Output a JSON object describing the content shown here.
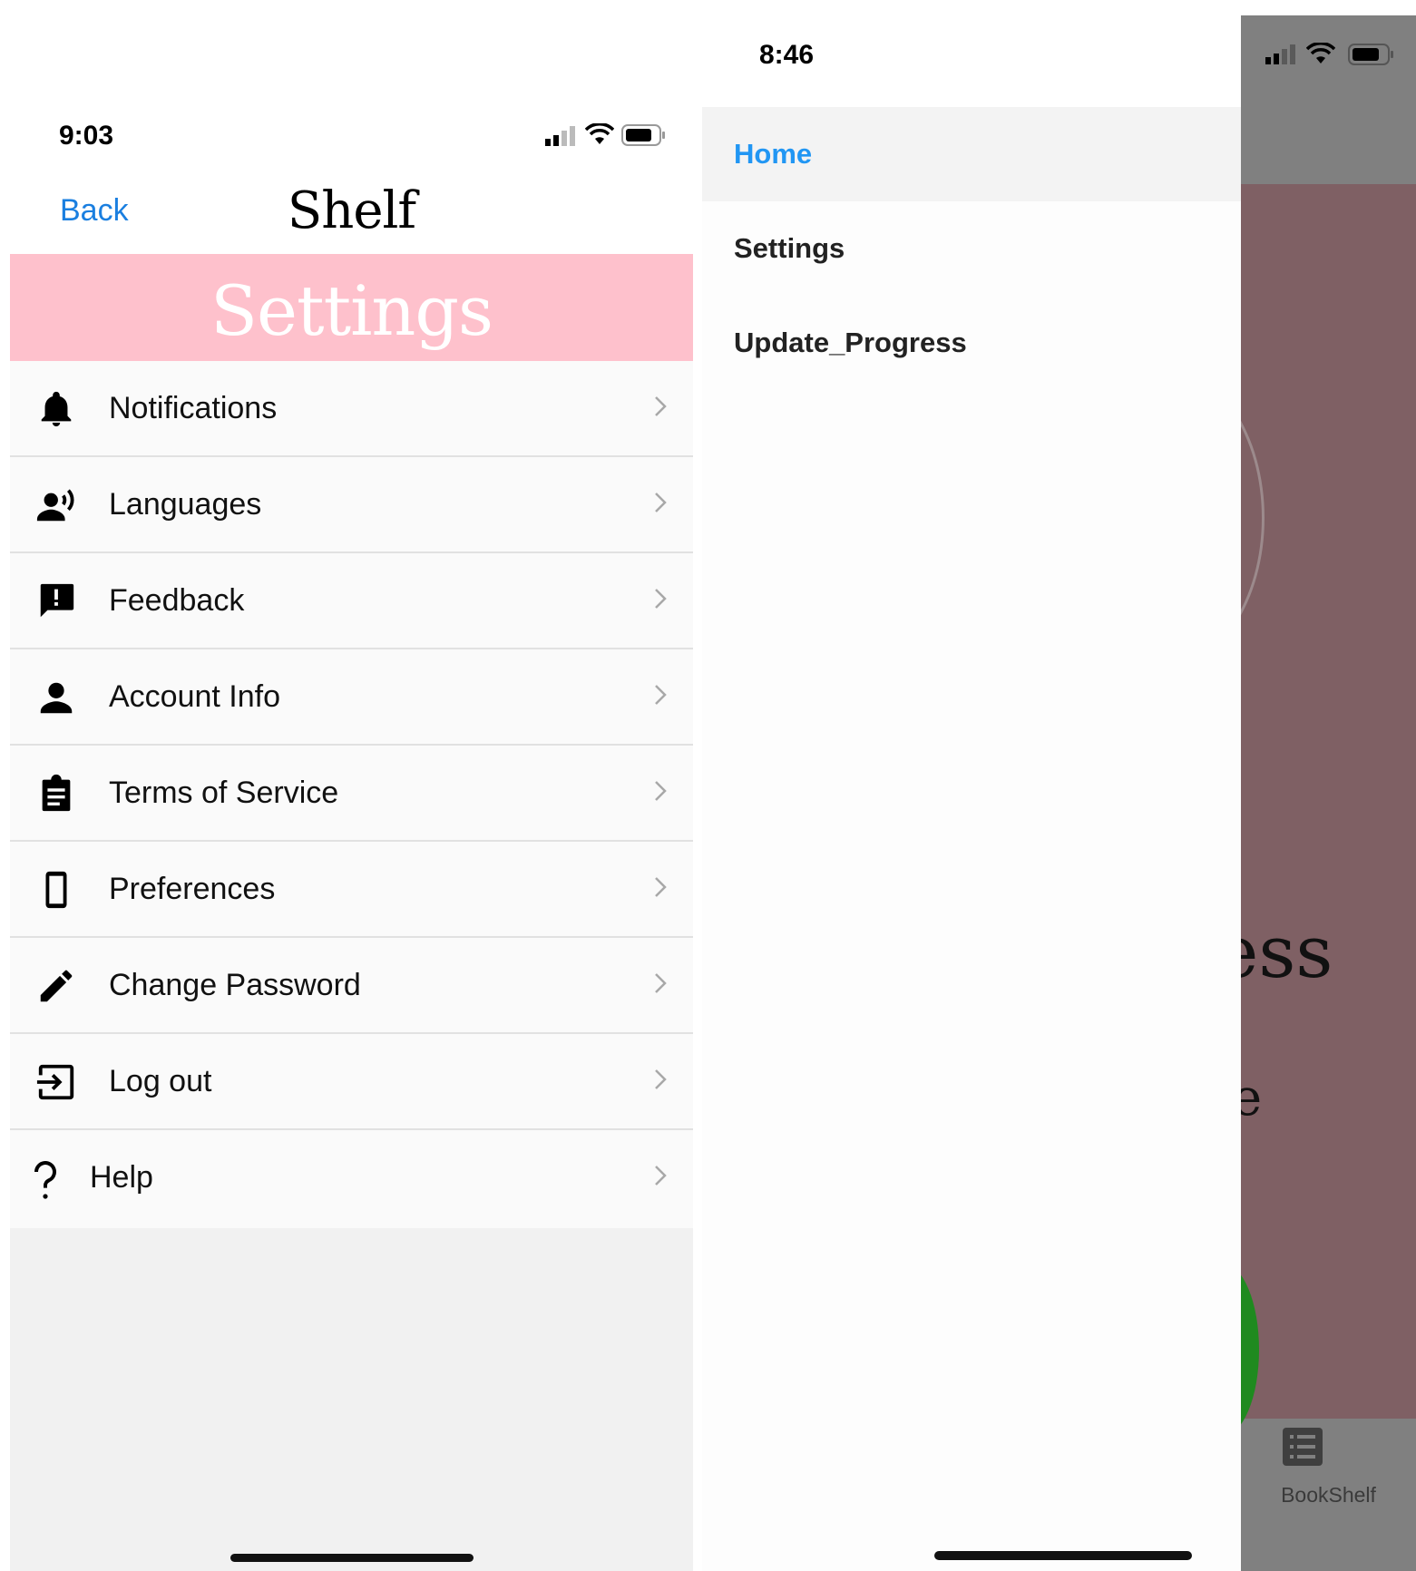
{
  "left_phone": {
    "status_bar": {
      "time": "9:03"
    },
    "nav": {
      "back_label": "Back",
      "title": "Shelf"
    },
    "banner_title": "Settings",
    "settings_items": [
      {
        "label": "Notifications",
        "icon": "bell-icon"
      },
      {
        "label": "Languages",
        "icon": "voice-person-icon"
      },
      {
        "label": "Feedback",
        "icon": "feedback-icon"
      },
      {
        "label": "Account Info",
        "icon": "person-icon"
      },
      {
        "label": "Terms of Service",
        "icon": "clipboard-icon"
      },
      {
        "label": "Preferences",
        "icon": "phone-icon"
      },
      {
        "label": "Change Password",
        "icon": "pencil-icon"
      },
      {
        "label": "Log out",
        "icon": "logout-icon"
      },
      {
        "label": "Help",
        "icon": "question-icon"
      }
    ],
    "colors": {
      "banner": "#fec1cc",
      "link": "#1a7fe0"
    }
  },
  "right_phone": {
    "status_bar": {
      "time": "8:46"
    },
    "drawer_items": [
      {
        "label": "Home",
        "active": true
      },
      {
        "label": "Settings",
        "active": false
      },
      {
        "label": "Update_Progress",
        "active": false
      }
    ],
    "background": {
      "partial_text_1": "ess",
      "partial_text_2": "e",
      "tab_label": "BookShelf"
    },
    "colors": {
      "active_item": "#2196f3",
      "overlay": "#808080",
      "content": "#7f6064"
    }
  }
}
